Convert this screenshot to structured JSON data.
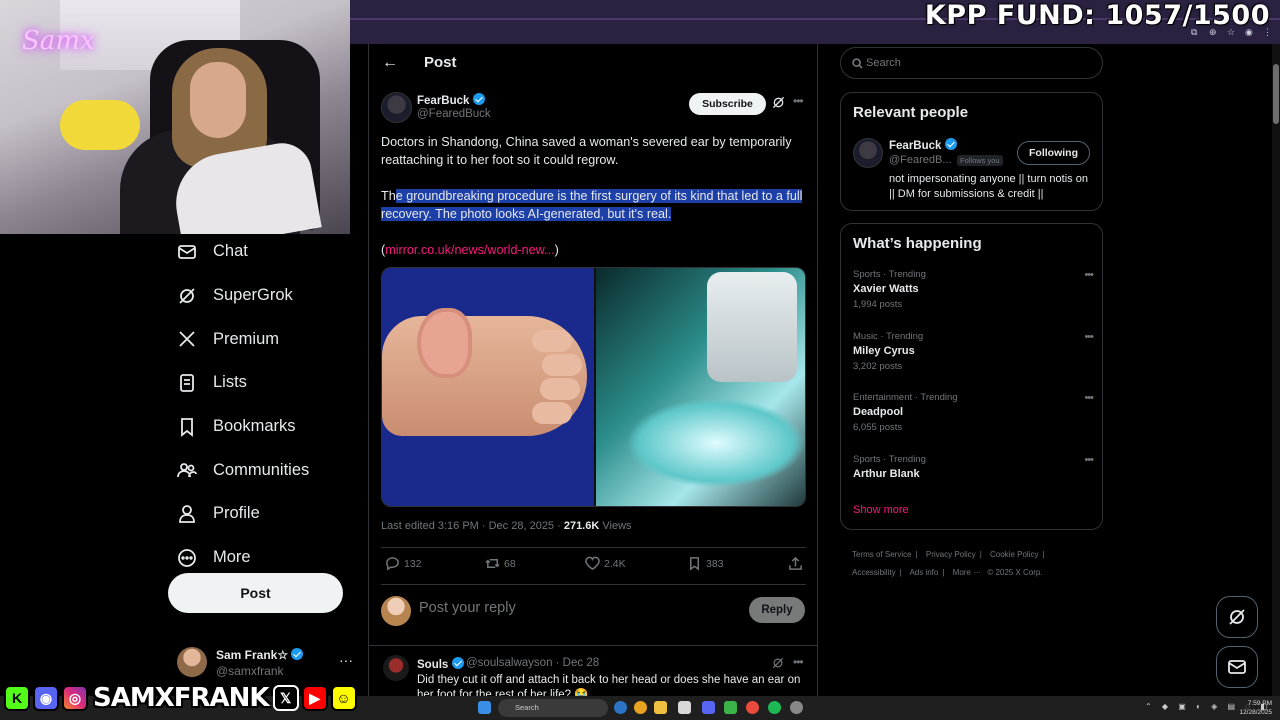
{
  "overlay": {
    "fund_text": "KPP FUND: 1057/1500",
    "webcam_sign": "Samx",
    "social_name": "SAMXFRANK",
    "social_icons": [
      "kick-icon",
      "discord-icon",
      "instagram-icon",
      "x-icon",
      "youtube-icon",
      "snapchat-icon"
    ]
  },
  "nav": {
    "items": [
      {
        "label": "Chat",
        "icon": "mail-icon"
      },
      {
        "label": "SuperGrok",
        "icon": "grok-icon"
      },
      {
        "label": "Premium",
        "icon": "x-logo-icon"
      },
      {
        "label": "Lists",
        "icon": "list-icon"
      },
      {
        "label": "Bookmarks",
        "icon": "bookmark-icon"
      },
      {
        "label": "Communities",
        "icon": "communities-icon"
      },
      {
        "label": "Profile",
        "icon": "profile-icon"
      },
      {
        "label": "More",
        "icon": "more-circle-icon"
      }
    ],
    "post_button": "Post",
    "account": {
      "name": "Sam Frank☆",
      "handle": "@samxfrank",
      "menu": "···"
    }
  },
  "main": {
    "header_title": "Post",
    "author": {
      "name": "FearBuck",
      "handle": "@FearedBuck"
    },
    "subscribe_label": "Subscribe",
    "tweet": {
      "p1": "Doctors in Shandong, China saved a woman's severed ear by temporarily reattaching it to her foot so it could regrow.",
      "p2_pre": "Th",
      "p2_hl": "e groundbreaking procedure is the first surgery of its kind that led to a full recovery. The photo looks AI-generated, but it's real.",
      "link_open": "(",
      "link": "mirror.co.uk/news/world-new...",
      "link_close": ")"
    },
    "meta": {
      "edited": "Last edited 3:16 PM · Dec 28, 2025 · ",
      "views_count": "271.6K",
      "views_label": " Views"
    },
    "actions": {
      "replies": "132",
      "reposts": "68",
      "likes": "2.4K",
      "bookmarks": "383"
    },
    "reply_placeholder": "Post your reply",
    "reply_button": "Reply",
    "reply": {
      "name": "Souls",
      "handle": "@soulsalwayson · Dec 28",
      "text": "Did they cut it off and attach it back to her head or does she have an ear on her foot for the rest of her life? 😭"
    }
  },
  "sidebar": {
    "search_placeholder": "Search",
    "relevant_title": "Relevant people",
    "person": {
      "name": "FearBuck",
      "handle": "@FearedB...",
      "follows_you": "Follows you",
      "button": "Following",
      "bio": "not impersonating anyone || turn notis on || DM for submissions & credit ||"
    },
    "happening_title": "What’s happening",
    "trends": [
      {
        "context": "Sports · Trending",
        "name": "Xavier Watts",
        "count": "1,994 posts"
      },
      {
        "context": "Music · Trending",
        "name": "Miley Cyrus",
        "count": "3,202 posts"
      },
      {
        "context": "Entertainment · Trending",
        "name": "Deadpool",
        "count": "6,055 posts"
      },
      {
        "context": "Sports · Trending",
        "name": "Arthur Blank",
        "count": ""
      }
    ],
    "show_more": "Show more",
    "footer": [
      "Terms of Service",
      "Privacy Policy",
      "Cookie Policy",
      "Accessibility",
      "Ads info",
      "More ···",
      "© 2025 X Corp."
    ]
  },
  "taskbar": {
    "search": "Search",
    "time": "7:59 PM",
    "date": "12/28/2025"
  },
  "colors": {
    "accent": "#1d9bf0",
    "link": "#f91880",
    "highlight": "#1c3fa8",
    "chrome": "#2b2140"
  }
}
